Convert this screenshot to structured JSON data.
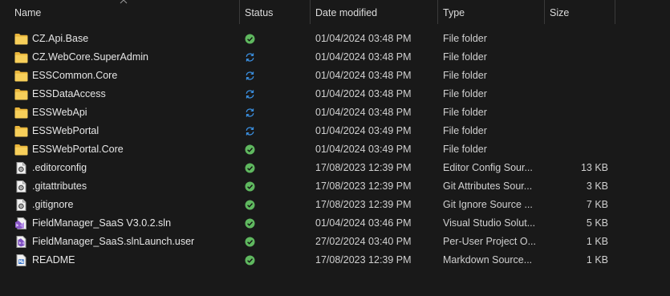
{
  "columns": {
    "name": "Name",
    "status": "Status",
    "date_modified": "Date modified",
    "type": "Type",
    "size": "Size"
  },
  "colors": {
    "background": "#191919",
    "folder": "#f3c445",
    "status_ok": "#5fb85f",
    "status_sync": "#3a8fe0"
  },
  "files": [
    {
      "name": "CZ.Api.Base",
      "icon": "folder-icon",
      "status": "synced-icon",
      "date": "01/04/2024 03:48 PM",
      "type": "File folder",
      "size": ""
    },
    {
      "name": "CZ.WebCore.SuperAdmin",
      "icon": "folder-icon",
      "status": "syncing-icon",
      "date": "01/04/2024 03:48 PM",
      "type": "File folder",
      "size": ""
    },
    {
      "name": "ESSCommon.Core",
      "icon": "folder-icon",
      "status": "syncing-icon",
      "date": "01/04/2024 03:48 PM",
      "type": "File folder",
      "size": ""
    },
    {
      "name": "ESSDataAccess",
      "icon": "folder-icon",
      "status": "syncing-icon",
      "date": "01/04/2024 03:48 PM",
      "type": "File folder",
      "size": ""
    },
    {
      "name": "ESSWebApi",
      "icon": "folder-icon",
      "status": "syncing-icon",
      "date": "01/04/2024 03:48 PM",
      "type": "File folder",
      "size": ""
    },
    {
      "name": "ESSWebPortal",
      "icon": "folder-icon",
      "status": "syncing-icon",
      "date": "01/04/2024 03:49 PM",
      "type": "File folder",
      "size": ""
    },
    {
      "name": "ESSWebPortal.Core",
      "icon": "folder-icon",
      "status": "synced-icon",
      "date": "01/04/2024 03:49 PM",
      "type": "File folder",
      "size": ""
    },
    {
      "name": ".editorconfig",
      "icon": "config-file-icon",
      "status": "synced-icon",
      "date": "17/08/2023 12:39 PM",
      "type": "Editor Config Sour...",
      "size": "13 KB"
    },
    {
      "name": ".gitattributes",
      "icon": "config-file-icon",
      "status": "synced-icon",
      "date": "17/08/2023 12:39 PM",
      "type": "Git Attributes Sour...",
      "size": "3 KB"
    },
    {
      "name": ".gitignore",
      "icon": "config-file-icon",
      "status": "synced-icon",
      "date": "17/08/2023 12:39 PM",
      "type": "Git Ignore Source ...",
      "size": "7 KB"
    },
    {
      "name": "FieldManager_SaaS V3.0.2.sln",
      "icon": "visual-studio-solution-icon",
      "status": "synced-icon",
      "date": "01/04/2024 03:46 PM",
      "type": "Visual Studio Solut...",
      "size": "5 KB"
    },
    {
      "name": "FieldManager_SaaS.slnLaunch.user",
      "icon": "user-project-file-icon",
      "status": "synced-icon",
      "date": "27/02/2024 03:40 PM",
      "type": "Per-User Project O...",
      "size": "1 KB"
    },
    {
      "name": "README",
      "icon": "markdown-file-icon",
      "status": "synced-icon",
      "date": "17/08/2023 12:39 PM",
      "type": "Markdown Source...",
      "size": "1 KB"
    }
  ]
}
